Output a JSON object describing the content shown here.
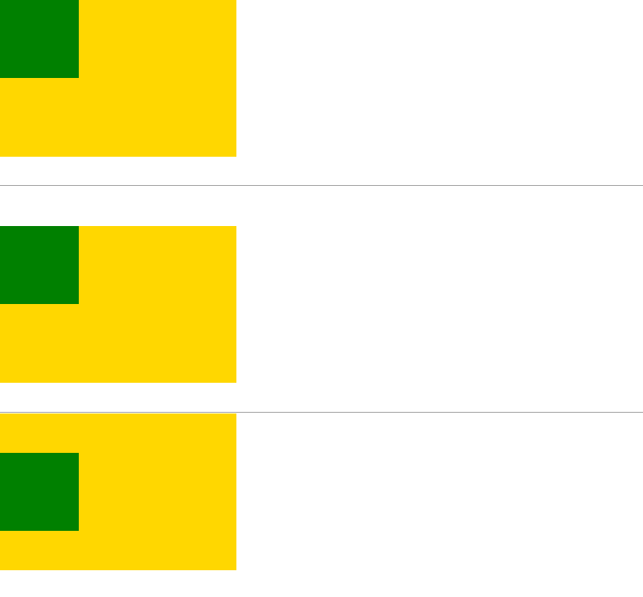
{
  "colors": {
    "panel": "#FFD700",
    "square": "#008000",
    "divider": "#9E9E9E",
    "background": "#FFFFFF"
  },
  "blocks": [
    {
      "square_alignment": "top"
    },
    {
      "square_alignment": "top"
    },
    {
      "square_alignment": "middle"
    }
  ]
}
